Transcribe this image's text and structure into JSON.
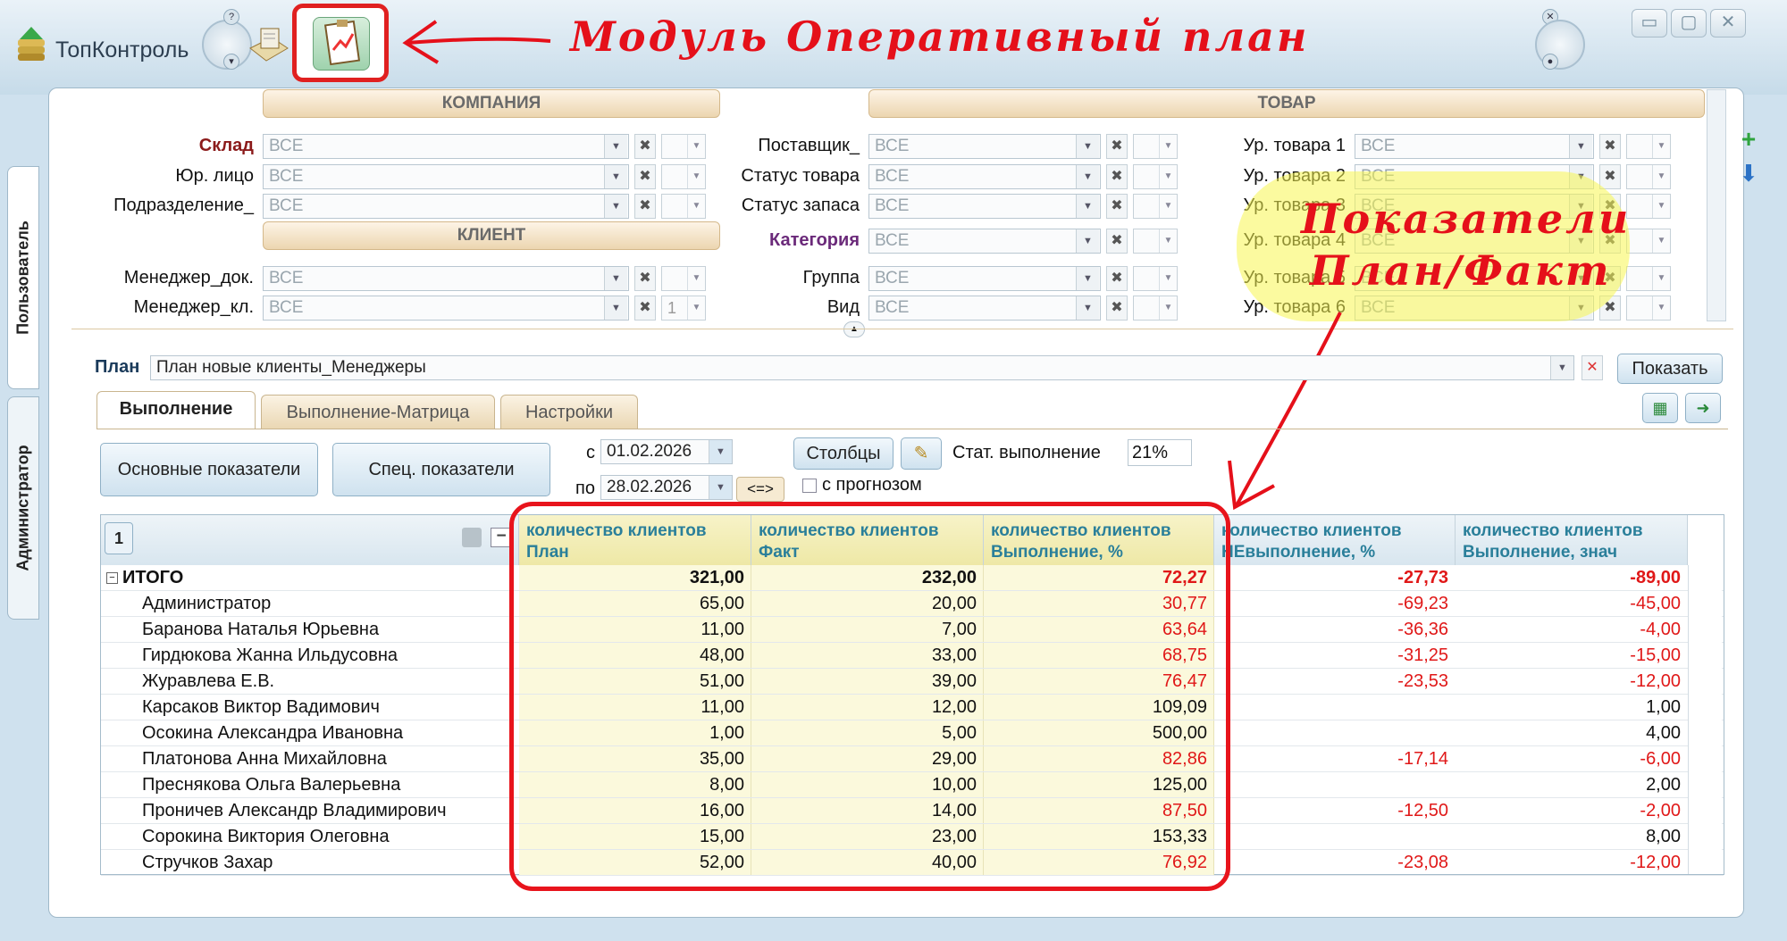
{
  "app": {
    "name": "ТопКонтроль"
  },
  "annotations": {
    "module": "Модуль Оперативный план",
    "indicators_l1": "Показатели",
    "indicators_l2": "План/Факт"
  },
  "window": {
    "minimize": "▭",
    "maximize": "▢",
    "close": "✕"
  },
  "sidetabs": {
    "user": "Пользователь",
    "admin": "Администратор"
  },
  "sections": {
    "company": "КОМПАНИЯ",
    "client": "КЛИЕНТ",
    "goods": "ТОВАР"
  },
  "filters": {
    "all": "ВСЕ",
    "col1": [
      "Склад",
      "Юр. лицо",
      "Подразделение_",
      "Менеджер_док.",
      "Менеджер_кл."
    ],
    "col2": [
      "Поставщик_",
      "Статус товара",
      "Статус запаса",
      "Категория",
      "Группа",
      "Вид"
    ],
    "col3": [
      "Ур. товара 1",
      "Ур. товара 2",
      "Ур. товара 3",
      "Ур. товара 4",
      "Ур. товара 5",
      "Ур. товара 6"
    ],
    "manager_cl_count": "1"
  },
  "plan": {
    "label": "План",
    "value": "План новые клиенты_Менеджеры",
    "show": "Показать"
  },
  "tabs": [
    "Выполнение",
    "Выполнение-Матрица",
    "Настройки"
  ],
  "toolbar": {
    "main": "Основные показатели",
    "spec": "Спец. показатели",
    "from_lbl": "с",
    "from": "01.02.2026",
    "to_lbl": "по",
    "to": "28.02.2026",
    "swap": "<=>",
    "columns": "Столбцы",
    "stat_lbl": "Стат. выполнение",
    "stat": "21%",
    "forecast": "с прогнозом"
  },
  "grid": {
    "group_level": "1",
    "headers": [
      {
        "l1": "количество клиентов",
        "l2": "План"
      },
      {
        "l1": "количество клиентов",
        "l2": "Факт"
      },
      {
        "l1": "количество клиентов",
        "l2": "Выполнение, %"
      },
      {
        "l1": "количество клиентов",
        "l2": "НЕвыполнение, %"
      },
      {
        "l1": "количество клиентов",
        "l2": "Выполнение, знач"
      }
    ],
    "total": {
      "name": "ИТОГО",
      "v": [
        "321,00",
        "232,00",
        "72,27",
        "-27,73",
        "-89,00"
      ]
    },
    "rows": [
      {
        "name": "Администратор",
        "v": [
          "65,00",
          "20,00",
          "30,77",
          "-69,23",
          "-45,00"
        ]
      },
      {
        "name": "Баранова Наталья Юрьевна",
        "v": [
          "11,00",
          "7,00",
          "63,64",
          "-36,36",
          "-4,00"
        ]
      },
      {
        "name": "Гирдюкова Жанна Ильдусовна",
        "v": [
          "48,00",
          "33,00",
          "68,75",
          "-31,25",
          "-15,00"
        ]
      },
      {
        "name": "Журавлева Е.В.",
        "v": [
          "51,00",
          "39,00",
          "76,47",
          "-23,53",
          "-12,00"
        ]
      },
      {
        "name": "Карсаков Виктор Вадимович",
        "v": [
          "11,00",
          "12,00",
          "109,09",
          "",
          "1,00"
        ]
      },
      {
        "name": "Осокина Александра Ивановна",
        "v": [
          "1,00",
          "5,00",
          "500,00",
          "",
          "4,00"
        ]
      },
      {
        "name": "Платонова Анна Михайловна",
        "v": [
          "35,00",
          "29,00",
          "82,86",
          "-17,14",
          "-6,00"
        ]
      },
      {
        "name": "Преснякова Ольга Валерьевна",
        "v": [
          "8,00",
          "10,00",
          "125,00",
          "",
          "2,00"
        ]
      },
      {
        "name": "Проничев Александр Владимирович",
        "v": [
          "16,00",
          "14,00",
          "87,50",
          "-12,50",
          "-2,00"
        ]
      },
      {
        "name": "Сорокина Виктория Олеговна",
        "v": [
          "15,00",
          "23,00",
          "153,33",
          "",
          "8,00"
        ]
      },
      {
        "name": "Стручков Захар",
        "v": [
          "52,00",
          "40,00",
          "76,92",
          "-23,08",
          "-12,00"
        ]
      }
    ]
  },
  "colors": {
    "accent": "#e5101a",
    "header_text": "#2a7f9a",
    "negative": "#e01818",
    "highlight": "#fbf9dc"
  }
}
